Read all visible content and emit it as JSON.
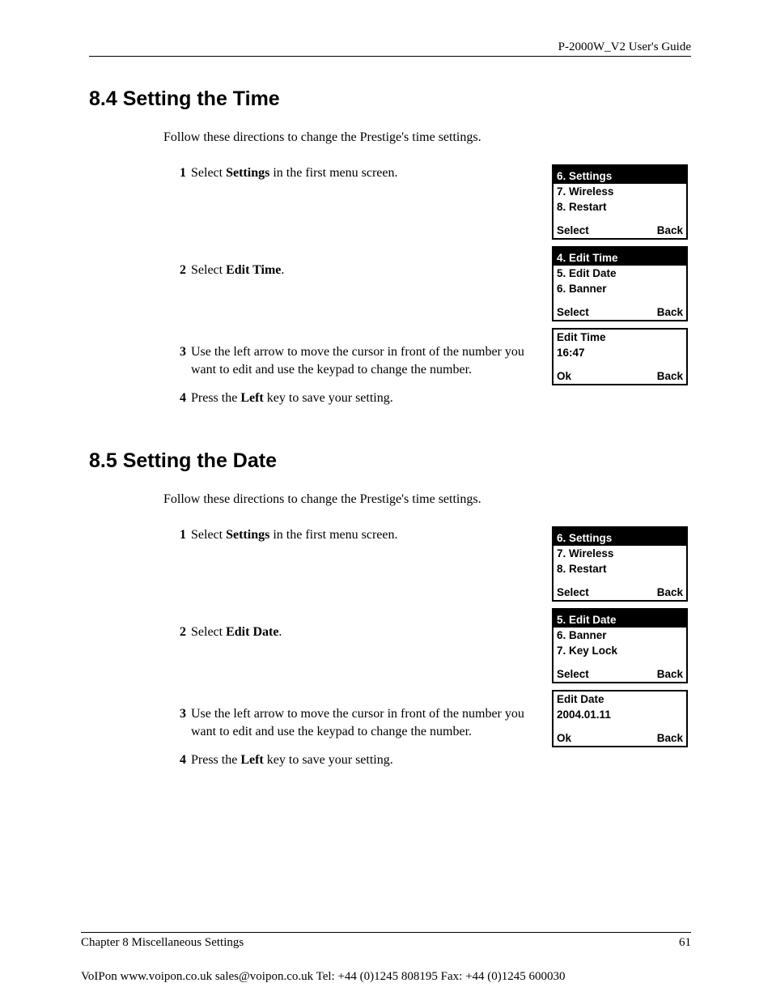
{
  "header": {
    "guide": "P-2000W_V2 User's Guide"
  },
  "sec84": {
    "heading": "8.4  Setting the Time",
    "intro": "Follow these directions to change the Prestige's time settings.",
    "step1": {
      "n": "1",
      "a": "Select ",
      "b": "Settings",
      "c": " in the first menu screen."
    },
    "step2": {
      "n": "2",
      "a": "Select ",
      "b": "Edit Time",
      "c": "."
    },
    "step3": {
      "n": "3",
      "a": "Use the left arrow to move the cursor in front of the number you want to edit and use the keypad to change the number."
    },
    "step4": {
      "n": "4",
      "a": "Press the ",
      "b": "Left",
      "c": " key to save your setting."
    },
    "lcd1": {
      "hl": "6. Settings",
      "l1": "7. Wireless",
      "l2": "8. Restart",
      "left": "Select",
      "right": "Back"
    },
    "lcd2": {
      "hl": "4. Edit Time",
      "l1": "5. Edit Date",
      "l2": "6. Banner",
      "left": "Select",
      "right": "Back"
    },
    "lcd3": {
      "l1": "Edit Time",
      "l2": "16:47",
      "left": "Ok",
      "right": "Back"
    }
  },
  "sec85": {
    "heading": "8.5  Setting the Date",
    "intro": "Follow these directions to change the Prestige's time settings.",
    "step1": {
      "n": "1",
      "a": "Select ",
      "b": "Settings",
      "c": " in the first menu screen."
    },
    "step2": {
      "n": "2",
      "a": "Select ",
      "b": "Edit Date",
      "c": "."
    },
    "step3": {
      "n": "3",
      "a": "Use the left arrow to move the cursor in front of the number you want to edit and use the keypad to change the number."
    },
    "step4": {
      "n": "4",
      "a": "Press the ",
      "b": "Left",
      "c": " key to save your setting."
    },
    "lcd1": {
      "hl": "6. Settings",
      "l1": "7. Wireless",
      "l2": "8. Restart",
      "left": "Select",
      "right": "Back"
    },
    "lcd2": {
      "hl": "5. Edit Date",
      "l1": "6. Banner",
      "l2": "7. Key Lock",
      "left": "Select",
      "right": "Back"
    },
    "lcd3": {
      "l1": "Edit Date",
      "l2": "2004.01.11",
      "left": "Ok",
      "right": "Back"
    }
  },
  "footer": {
    "chapter": "Chapter 8 Miscellaneous Settings",
    "page": "61"
  },
  "contact": {
    "text": "VoIPon     www.voipon.co.uk     sales@voipon.co.uk      Tel: +44 (0)1245 808195      Fax: +44 (0)1245 600030"
  }
}
